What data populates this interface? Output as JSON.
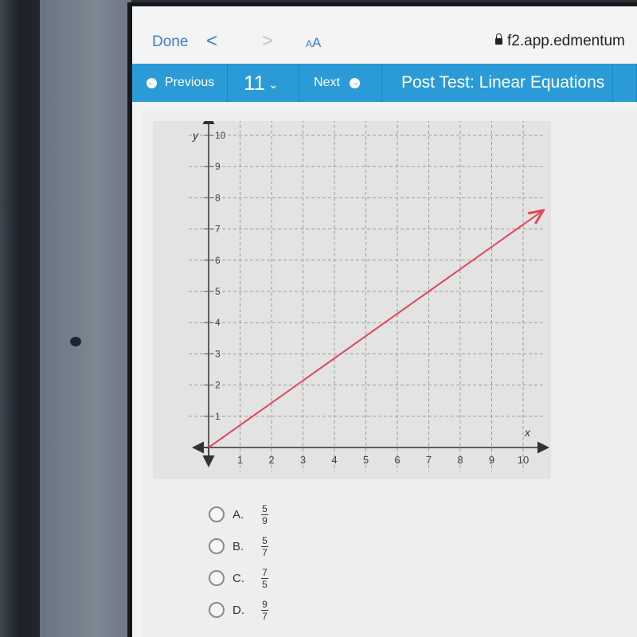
{
  "browser": {
    "done_label": "Done",
    "back_glyph": "<",
    "forward_glyph": ">",
    "text_size_label_small": "A",
    "text_size_label_large": "A",
    "url": "f2.app.edmentum"
  },
  "nav": {
    "previous_label": "Previous",
    "question_number": "11",
    "next_label": "Next",
    "title": "Post Test: Linear Equations",
    "accent_color": "#2a9bd6"
  },
  "chart_data": {
    "type": "line",
    "title": "",
    "xlabel": "x",
    "ylabel": "y",
    "xlim": [
      0,
      10
    ],
    "ylim": [
      0,
      10
    ],
    "x_ticks": [
      "1",
      "2",
      "3",
      "4",
      "5",
      "6",
      "7",
      "8",
      "9",
      "10"
    ],
    "y_ticks": [
      "1",
      "2",
      "3",
      "4",
      "5",
      "6",
      "7",
      "8",
      "9",
      "10"
    ],
    "grid": true,
    "series": [
      {
        "name": "line",
        "color": "#e0475a",
        "x": [
          0,
          7,
          10.6
        ],
        "y": [
          0,
          5,
          7.57
        ]
      }
    ]
  },
  "question": {
    "choices": [
      {
        "letter": "A.",
        "numerator": "5",
        "denominator": "9"
      },
      {
        "letter": "B.",
        "numerator": "5",
        "denominator": "7"
      },
      {
        "letter": "C.",
        "numerator": "7",
        "denominator": "5"
      },
      {
        "letter": "D.",
        "numerator": "9",
        "denominator": "7"
      }
    ]
  }
}
